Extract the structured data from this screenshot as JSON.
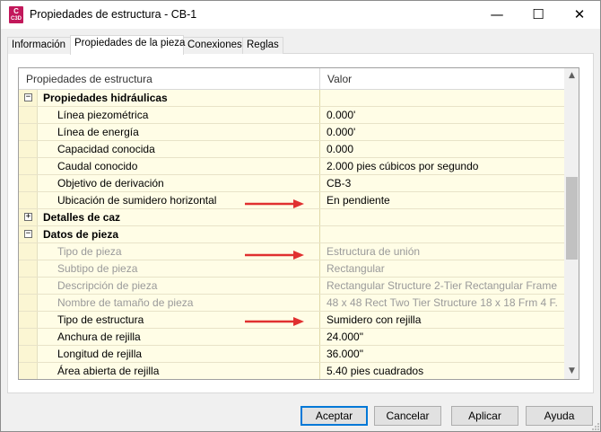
{
  "window": {
    "title": "Propiedades de estructura - CB-1",
    "app_icon_text": "C",
    "app_icon_sub": "C3D",
    "minimize_icon": "minimize-icon",
    "maximize_icon": "maximize-icon",
    "close_icon": "close-icon",
    "minimize_glyph": "—",
    "maximize_glyph": "☐",
    "close_glyph": "✕"
  },
  "tabs": [
    {
      "label": "Información",
      "active": false
    },
    {
      "label": "Propiedades de la pieza",
      "active": true
    },
    {
      "label": "Conexiones",
      "active": false
    },
    {
      "label": "Reglas",
      "active": false
    }
  ],
  "grid": {
    "headers": [
      "Propiedades de estructura",
      "Valor"
    ],
    "rows": [
      {
        "type": "group",
        "expander": "⊟",
        "label": "Propiedades hidráulicas",
        "value": ""
      },
      {
        "type": "item",
        "label": "Línea piezométrica",
        "value": "0.000'"
      },
      {
        "type": "item",
        "label": "Línea de energía",
        "value": "0.000'"
      },
      {
        "type": "item",
        "label": "Capacidad conocida",
        "value": "0.000"
      },
      {
        "type": "item",
        "label": "Caudal conocido",
        "value": "2.000 pies cúbicos por segundo"
      },
      {
        "type": "item",
        "label": "Objetivo de derivación",
        "value": "CB-3"
      },
      {
        "type": "item",
        "label": "Ubicación de sumidero horizontal",
        "value": "En pendiente"
      },
      {
        "type": "group",
        "expander": "⊞",
        "label": "Detalles de caz",
        "value": ""
      },
      {
        "type": "group",
        "expander": "⊟",
        "label": "Datos de pieza",
        "value": ""
      },
      {
        "type": "disabled",
        "label": "Tipo de pieza",
        "value": "Estructura de unión"
      },
      {
        "type": "disabled",
        "label": "Subtipo de pieza",
        "value": "Rectangular"
      },
      {
        "type": "disabled",
        "label": "Descripción de pieza",
        "value": "Rectangular Structure 2-Tier Rectangular Frame"
      },
      {
        "type": "disabled",
        "label": "Nombre de tamaño de pieza",
        "value": "48 x 48 Rect Two Tier Structure 18 x 18 Frm 4 F..."
      },
      {
        "type": "item",
        "label": "Tipo de estructura",
        "value": "Sumidero con rejilla"
      },
      {
        "type": "item",
        "label": "Anchura de rejilla",
        "value": "24.000\""
      },
      {
        "type": "item",
        "label": "Longitud de rejilla",
        "value": "36.000\""
      },
      {
        "type": "item",
        "label": "Área abierta de rejilla",
        "value": "5.40 pies cuadrados"
      }
    ],
    "scroll_up_glyph": "▲",
    "scroll_down_glyph": "▼"
  },
  "annotation_color": "#e03030",
  "buttons": {
    "ok": "Aceptar",
    "cancel": "Cancelar",
    "apply": "Aplicar",
    "help": "Ayuda"
  }
}
